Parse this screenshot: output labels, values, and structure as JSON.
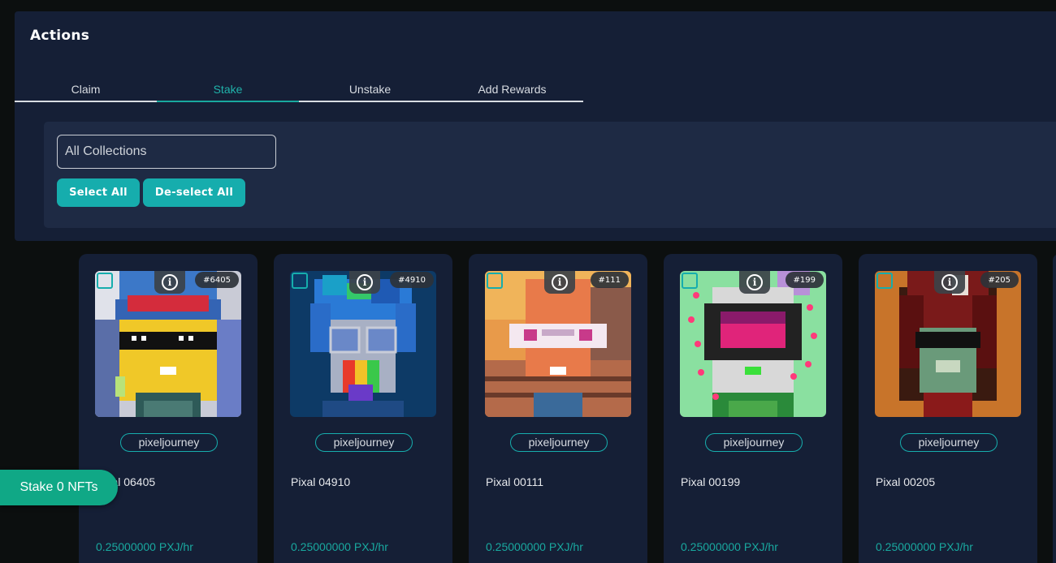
{
  "actions": {
    "title": "Actions",
    "tabs": [
      {
        "label": "Claim",
        "active": false
      },
      {
        "label": "Stake",
        "active": true
      },
      {
        "label": "Unstake",
        "active": false
      },
      {
        "label": "Add Rewards",
        "active": false
      }
    ],
    "collection_placeholder": "All Collections",
    "select_all_label": "Select All",
    "deselect_all_label": "De-select All"
  },
  "cards": [
    {
      "badge": "#6405",
      "collection": "pixeljourney",
      "name": "Pixal 06405",
      "rate": "0.25000000 PXJ/hr",
      "checked": false,
      "art": "blue-cap-yellow-face"
    },
    {
      "badge": "#4910",
      "collection": "pixeljourney",
      "name": "Pixal 04910",
      "rate": "0.25000000 PXJ/hr",
      "checked": false,
      "art": "blue-hair-rainbow"
    },
    {
      "badge": "#111",
      "collection": "pixeljourney",
      "name": "Pixal 00111",
      "rate": "0.25000000 PXJ/hr",
      "checked": false,
      "art": "orange-thug-glasses"
    },
    {
      "badge": "#199",
      "collection": "pixeljourney",
      "name": "Pixal 00199",
      "rate": "0.25000000 PXJ/hr",
      "checked": false,
      "art": "green-robot-hearts"
    },
    {
      "badge": "#205",
      "collection": "pixeljourney",
      "name": "Pixal 00205",
      "rate": "0.25000000 PXJ/hr",
      "checked": false,
      "art": "red-hair-zombie"
    }
  ],
  "stake_button_label": "Stake 0 NFTs",
  "colors": {
    "accent": "#16adad",
    "panel": "#151f36",
    "stake": "#10a886"
  },
  "icons": [
    "info-icon",
    "checkbox-icon"
  ]
}
